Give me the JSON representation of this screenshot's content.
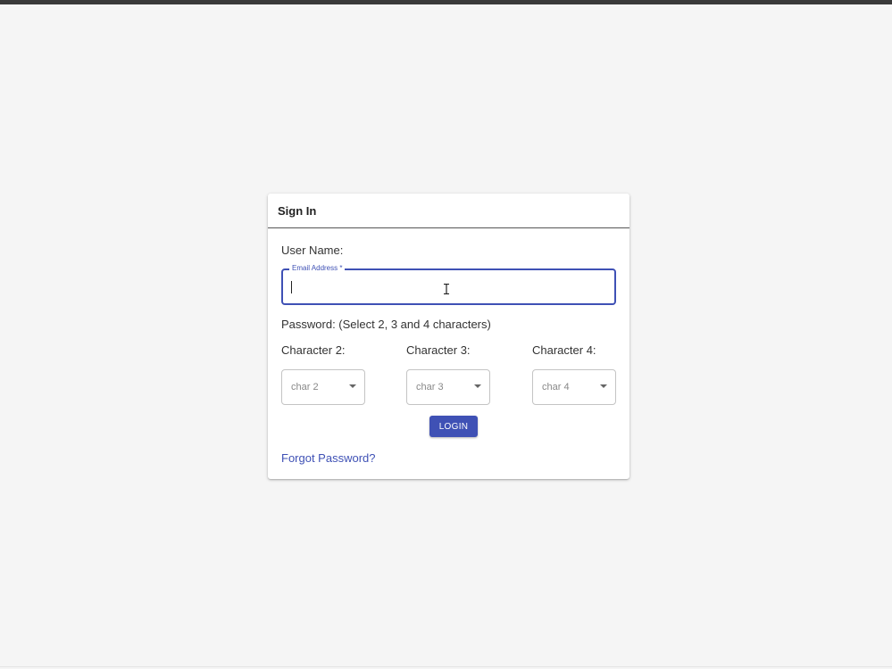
{
  "card": {
    "title": "Sign In"
  },
  "username": {
    "label": "User Name:",
    "field_label": "Email Address *",
    "value": ""
  },
  "password": {
    "label": "Password: (Select 2, 3 and 4 characters)",
    "characters": [
      {
        "label": "Character 2:",
        "placeholder": "char 2"
      },
      {
        "label": "Character 3:",
        "placeholder": "char 3"
      },
      {
        "label": "Character 4:",
        "placeholder": "char 4"
      }
    ]
  },
  "actions": {
    "login_label": "LOGIN",
    "forgot_label": "Forgot Password?"
  },
  "colors": {
    "primary": "#3f51b5",
    "background": "#f5f5f5"
  }
}
